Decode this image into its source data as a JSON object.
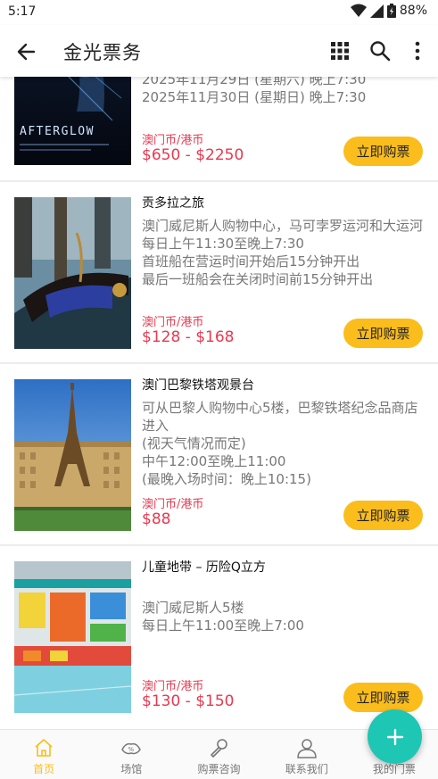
{
  "status_bar": {
    "time": "5:17",
    "battery": "88%"
  },
  "app_bar": {
    "title": "金光票务"
  },
  "events": [
    {
      "title": "",
      "description": [
        "2025年11月29日 (星期六) 晚上7:30",
        "2025年11月30日 (星期日) 晚上7:30"
      ],
      "currency": "澳门币/港币",
      "price": "$650 - $2250",
      "buy_label": "立即购票",
      "poster_text": "AFTERGLOW"
    },
    {
      "title": "贡多拉之旅",
      "description": [
        "澳门威尼斯人购物中心，马可孛罗运河和大运河",
        "每日上午11:30至晚上7:30",
        "首班船在营运时间开始后15分钟开出",
        "最后一班船会在关闭时间前15分钟开出"
      ],
      "currency": "澳门币/港币",
      "price": "$128 - $168",
      "buy_label": "立即购票"
    },
    {
      "title": "澳门巴黎铁塔观景台",
      "description": [
        "可从巴黎人购物中心5楼，巴黎铁塔纪念品商店进入",
        "(视天气情况而定)",
        "中午12:00至晚上11:00",
        "(最晚入场时间：晚上10:15)"
      ],
      "currency": "澳门币/港币",
      "price": "$88",
      "buy_label": "立即购票"
    },
    {
      "title": "儿童地带 – 历险Q立方",
      "description": [
        "澳门威尼斯人5楼",
        "每日上午11:00至晚上7:00"
      ],
      "currency": "澳门币/港币",
      "price": "$130 - $150",
      "buy_label": "立即购票"
    }
  ],
  "bottom_nav": [
    {
      "label": "首页",
      "icon": "home-icon",
      "active": true
    },
    {
      "label": "场馆",
      "icon": "venue-icon",
      "active": false
    },
    {
      "label": "购票咨询",
      "icon": "microphone-icon",
      "active": false
    },
    {
      "label": "联系我们",
      "icon": "person-icon",
      "active": false
    },
    {
      "label": "我的门票",
      "icon": "ticket-icon",
      "active": false
    }
  ],
  "colors": {
    "accent": "#fbbd1c",
    "price": "#e8384f",
    "fab": "#1ec6b4"
  }
}
